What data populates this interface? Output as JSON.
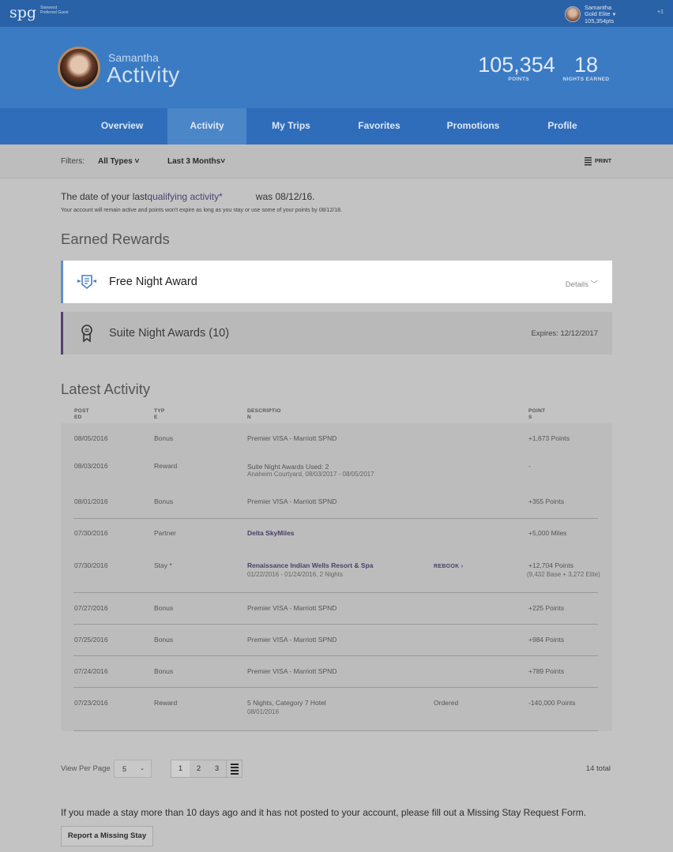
{
  "topbar": {
    "logo": "spg",
    "logo_sub": "Starwood Preferred Guest",
    "user_name": "Samantha",
    "user_tier": "Gold Elite",
    "user_points": "105,354pts",
    "notif_count": "+1"
  },
  "hero": {
    "name": "Samantha",
    "title": "Activity",
    "points_value": "105,354",
    "points_label": "POINTS",
    "nights_value": "18",
    "nights_label": "NIGHTS EARNED"
  },
  "nav": {
    "items": [
      "Overview",
      "Activity",
      "My Trips",
      "Favorites",
      "Promotions",
      "Profile"
    ],
    "active": "Activity"
  },
  "filters": {
    "label": "Filters:",
    "type": "All Types",
    "range": "Last 3 Months",
    "print": "PRINT"
  },
  "qualifying": {
    "prefix": "The date of your last",
    "link": "qualifying activity*",
    "suffix": "was 08/12/16.",
    "note": "Your account will remain active and points won't expire as long as you stay or use some of your points by 08/12/18."
  },
  "earned_rewards": {
    "title": "Earned Rewards",
    "cards": [
      {
        "icon": "award-ribbon-icon",
        "title": "Free Night Award",
        "right": "Details"
      },
      {
        "icon": "medal-icon",
        "title": "Suite Night Awards (10)",
        "right": "Expires: 12/12/2017"
      }
    ]
  },
  "latest_activity": {
    "title": "Latest Activity",
    "headers": {
      "date": "POSTED",
      "type": "TYPE",
      "desc": "DESCRIPTION",
      "points": "POINTS"
    },
    "rows": [
      {
        "date": "08/05/2016",
        "type": "Bonus",
        "desc": "Premier VISA - Marriott SPND",
        "sub": "",
        "extra": "",
        "points": "+1,673 Points",
        "points_sub": ""
      },
      {
        "date": "08/03/2016",
        "type": "Reward",
        "desc": "Suite Night Awards Used: 2",
        "sub": "Anaheim Courtyard, 08/03/2017 - 08/05/2017",
        "extra": "",
        "points": "-",
        "points_sub": ""
      },
      {
        "date": "08/01/2016",
        "type": "Bonus",
        "desc": "Premier VISA - Marriott SPND",
        "sub": "",
        "extra": "",
        "points": "+355 Points",
        "points_sub": ""
      },
      {
        "date": "07/30/2016",
        "type": "Partner",
        "desc": "Delta SkyMiles",
        "sub": "",
        "extra": "",
        "points": "+5,000 Miles",
        "points_sub": ""
      },
      {
        "date": "07/30/2016",
        "type": "Stay *",
        "desc": "Renaissance Indian Wells Resort & Spa",
        "sub": "01/22/2016 - 01/24/2016, 2 Nights",
        "extra": "REBOOK  ›",
        "points": "+12,704 Points",
        "points_sub": "(9,432 Base + 3,272 Elite)"
      },
      {
        "date": "07/27/2016",
        "type": "Bonus",
        "desc": "Premier VISA - Marriott SPND",
        "sub": "",
        "extra": "",
        "points": "+225 Points",
        "points_sub": ""
      },
      {
        "date": "07/25/2016",
        "type": "Bonus",
        "desc": "Premier VISA - Marriott SPND",
        "sub": "",
        "extra": "",
        "points": "+984 Points",
        "points_sub": ""
      },
      {
        "date": "07/24/2016",
        "type": "Bonus",
        "desc": "Premier VISA - Marriott SPND",
        "sub": "",
        "extra": "",
        "points": "+789 Points",
        "points_sub": ""
      },
      {
        "date": "07/23/2016",
        "type": "Reward",
        "desc": "5 Nights, Category 7 Hotel",
        "sub": "08/01/2016",
        "extra": "Ordered",
        "points": "-140,000 Points",
        "points_sub": ""
      }
    ]
  },
  "pagination": {
    "view_label": "View Per Page",
    "per_page": "5",
    "pages": [
      "1",
      "2",
      "3"
    ],
    "current": "1",
    "total": "14 total"
  },
  "missing_stay": {
    "text": "If you made a stay more than 10 days ago and it has not posted to your account, please fill out a Missing Stay Request Form.",
    "button": "Report a Missing Stay"
  }
}
